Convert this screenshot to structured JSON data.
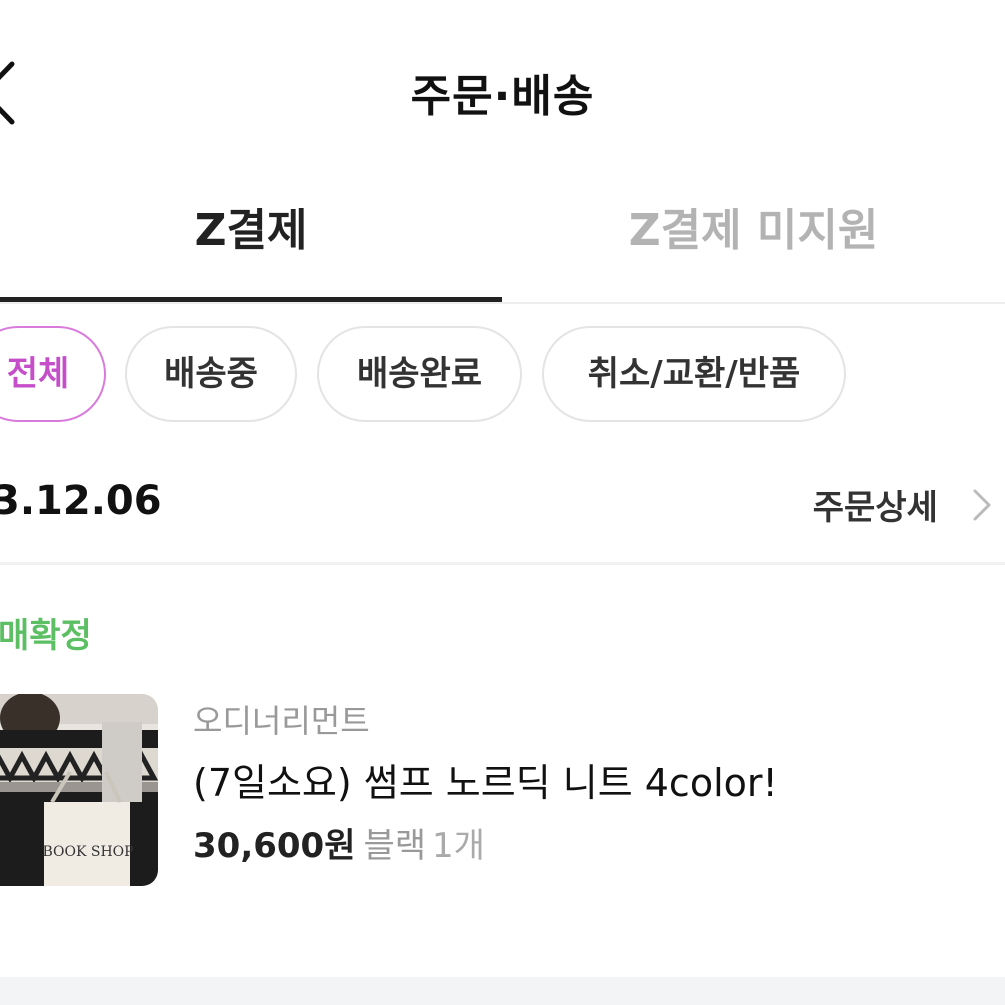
{
  "header": {
    "title": "주문·배송",
    "back_icon": "chevron-left-icon"
  },
  "tabs": [
    {
      "label": "Z결제",
      "active": true
    },
    {
      "label": "Z결제 미지원",
      "active": false
    }
  ],
  "filters": [
    {
      "label": "전체",
      "active": true
    },
    {
      "label": "배송중",
      "active": false
    },
    {
      "label": "배송완료",
      "active": false
    },
    {
      "label": "취소/교환/반품",
      "active": false
    }
  ],
  "order": {
    "date": "3.12.06",
    "detail_label": "주문상세",
    "status": "매확정",
    "item": {
      "seller": "오디너리먼트",
      "name": "(7일소요) 썸프 노르딕 니트 4color!",
      "price": "30,600원",
      "option": "블랙",
      "quantity": "1개",
      "bag_text": "BOOK SHOP"
    }
  },
  "colors": {
    "accent": "#c54fc9",
    "accent_border": "#d97bdc",
    "status_green": "#5cbf63"
  }
}
